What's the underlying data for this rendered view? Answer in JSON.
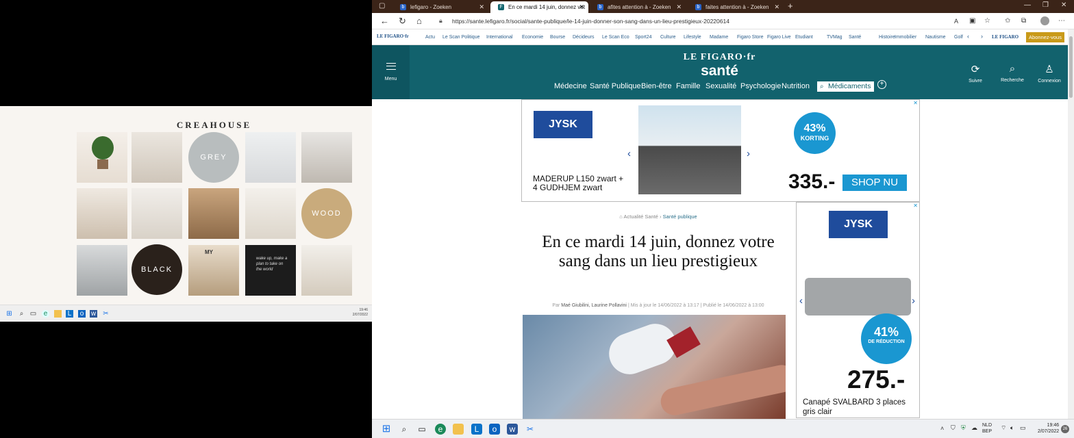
{
  "moodboard": {
    "title": "CREAHOUSE",
    "circle_labels": {
      "grey": "GREY",
      "wood": "WOOD",
      "black": "BLACK"
    },
    "tile_text": "wake up, make a plan to take on the world",
    "tile_sign": "MY",
    "time": "19:46",
    "date": "2/07/2022"
  },
  "browser": {
    "tabs": [
      {
        "label": "lefigaro - Zoeken",
        "icon": "bing-icon"
      },
      {
        "label": "En ce mardi 14 juin, donnez vot",
        "icon": "figaro-icon",
        "active": true
      },
      {
        "label": "afites attention à - Zoeken",
        "icon": "bing-icon"
      },
      {
        "label": "faites attention à - Zoeken",
        "icon": "bing-icon"
      }
    ],
    "url": "https://sante.lefigaro.fr/social/sante-publique/le-14-juin-donner-son-sang-dans-un-lieu-prestigieux-20220614"
  },
  "figaro_nav": {
    "logo": "LE FIGARO·fr",
    "items": [
      "Actu",
      "Le Scan Politique",
      "International",
      "Economie",
      "Bourse",
      "Décideurs",
      "Le Scan Eco",
      "Sport24",
      "Culture",
      "Lifestyle",
      "Madame",
      "Figaro Store",
      "Figaro Live",
      "Etudiant",
      "TVMag",
      "Santé",
      "Histoire",
      "Immobilier",
      "Nautisme",
      "Golf"
    ],
    "right_logo": "LE FIGARO",
    "subscribe": "Abonnez-vous"
  },
  "header": {
    "logo": "LE FIGARO·fr",
    "section": "santé",
    "menu": "Menu",
    "categories": [
      "Médecine",
      "Santé Publique",
      "Bien-être",
      "Famille",
      "Sexualité",
      "Psychologie",
      "Nutrition"
    ],
    "search_cat": "Médicaments",
    "follow": "Suivre",
    "search": "Recherche",
    "login": "Connexion"
  },
  "ad_top": {
    "brand": "JYSK",
    "product": "MADERUP L150 zwart + 4 GUDHJEM zwart",
    "discount_pct": "43%",
    "discount_label": "KORTING",
    "price": "335.-",
    "cta": "SHOP NU"
  },
  "ad_side": {
    "brand": "JYSK",
    "discount_pct": "41%",
    "discount_label": "DE RÉDUCTION",
    "price": "275.-",
    "product": "Canapé SVALBARD 3 places gris clair"
  },
  "article": {
    "breadcrumb_home": "Actualité Santé",
    "breadcrumb_section": "Santé publique",
    "title": "En ce mardi 14 juin, donnez votre sang dans un lieu prestigieux",
    "by": "Par",
    "authors": "Maé Giubilini, Laurine Pollavini",
    "updated": "Mis à jour le 14/06/2022 à 13:17",
    "published": "Publié le 14/06/2022 à 13:00"
  },
  "taskbar": {
    "lang1": "NLD",
    "lang2": "BEP",
    "time": "19:46",
    "date": "2/07/2022",
    "badge": "26"
  },
  "colors": {
    "figaro_teal": "#12626d",
    "jysk_blue": "#1f4c9c",
    "tab_bar": "#3b2418"
  }
}
